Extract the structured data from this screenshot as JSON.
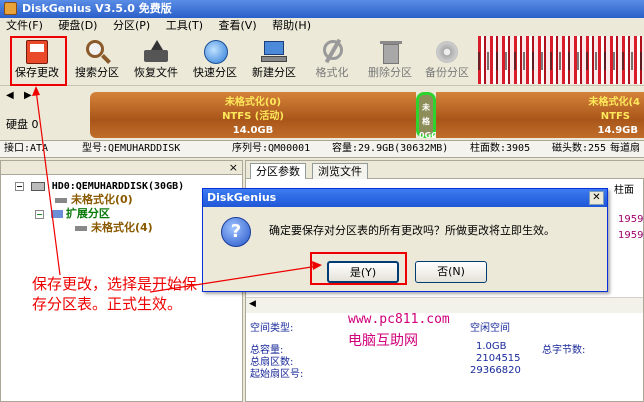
{
  "window": {
    "title": "DiskGenius V3.5.0 免费版"
  },
  "menu": [
    "文件(F)",
    "硬盘(D)",
    "分区(P)",
    "工具(T)",
    "查看(V)",
    "帮助(H)"
  ],
  "toolbar": {
    "save": "保存更改",
    "search": "搜索分区",
    "recover": "恢复文件",
    "quick": "快速分区",
    "new": "新建分区",
    "format": "格式化",
    "delete": "删除分区",
    "backup": "备份分区"
  },
  "disk_map": {
    "disk_label": "硬盘 0",
    "p1": {
      "name": "未格式化(0)",
      "fs": "NTFS (活动)",
      "size": "14.0GB"
    },
    "p2": {
      "name": "未格",
      "size": "0GC"
    },
    "p3": {
      "name": "未格式化(4",
      "fs": "NTFS",
      "size": "14.9GB"
    }
  },
  "info": {
    "iface": "接口:ATA",
    "model": "型号:QEMUHARDDISK",
    "serial": "序列号:QM00001",
    "capacity": "容量:29.9GB(30632MB)",
    "cylinders": "柱面数:3905",
    "heads": "磁头数:255",
    "sectors": "每道扇"
  },
  "tree": {
    "disk": "HD0:QEMUHARDDISK(30GB)",
    "p0": "未格式化(0)",
    "ext": "扩展分区",
    "p4": "未格式化(4)"
  },
  "tabs": {
    "params": "分区参数",
    "browse": "浏览文件"
  },
  "grid_right": {
    "col": "柱面",
    "v1": "1959",
    "v2": "1959"
  },
  "details": {
    "type_label": "空间类型:",
    "type_value": "空闲空间",
    "total_label": "总容量:",
    "total_value": "1.0GB",
    "total_bytes_label": "总字节数:",
    "sectors_label": "总扇区数:",
    "sectors_value": "2104515",
    "start_label": "起始扇区号:",
    "start_value": "29366820"
  },
  "dialog": {
    "title": "DiskGenius",
    "message": "确定要保存对分区表的所有更改吗？所做更改将立即生效。",
    "yes": "是(Y)",
    "no": "否(N)"
  },
  "annotation": "保存更改，选择是开始保存分区表。正式生效。",
  "watermark": {
    "url": "www.pc811.com",
    "name": "电脑互助网"
  }
}
